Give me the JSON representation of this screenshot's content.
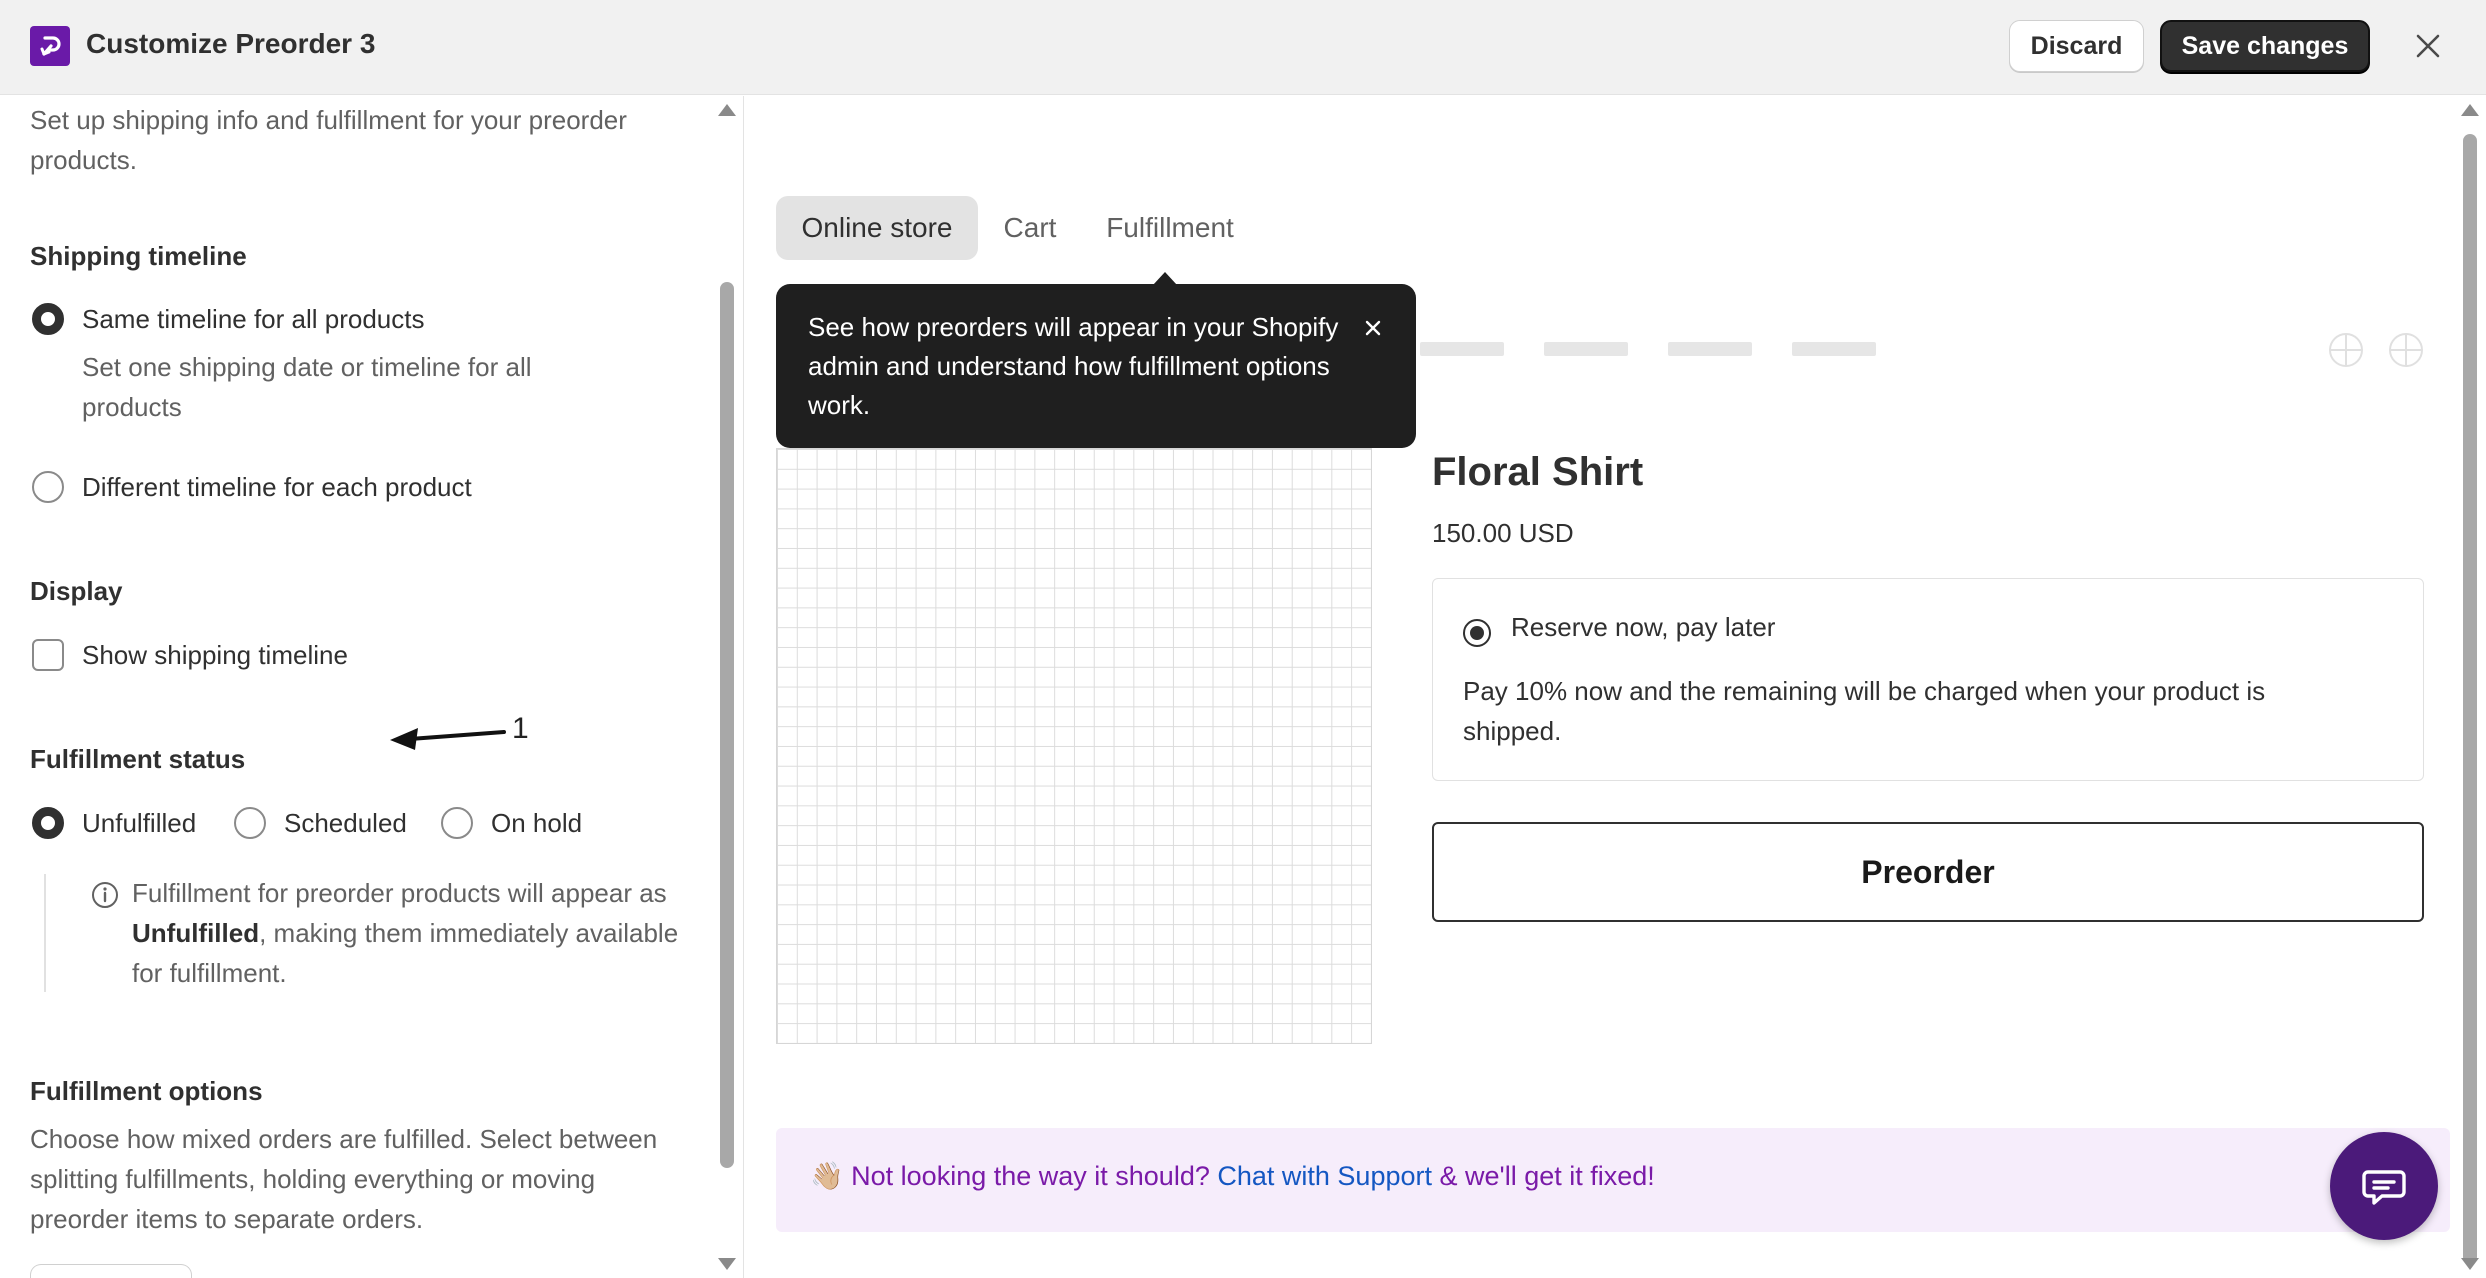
{
  "header": {
    "title": "Customize Preorder 3",
    "discard_label": "Discard",
    "save_label": "Save changes"
  },
  "left": {
    "intro": "Set up shipping info and fulfillment for your preorder products.",
    "shipping_timeline": {
      "heading": "Shipping timeline",
      "option1_label": "Same timeline for all products",
      "option1_help": "Set one shipping date or timeline for all products",
      "option2_label": "Different timeline for each product"
    },
    "display": {
      "heading": "Display",
      "checkbox_label": "Show shipping timeline",
      "checked": false
    },
    "annotation": "1",
    "fulfillment_status": {
      "heading": "Fulfillment status",
      "options": [
        "Unfulfilled",
        "Scheduled",
        "On hold"
      ],
      "selected": "Unfulfilled",
      "info_prefix": "Fulfillment for preorder products will appear as ",
      "info_bold": "Unfulfilled",
      "info_suffix": ", making them immediately available for fulfillment."
    },
    "fulfillment_options": {
      "heading": "Fulfillment options",
      "description": "Choose how mixed orders are fulfilled. Select between splitting fulfillments, holding everything or moving preorder items to separate orders."
    }
  },
  "preview": {
    "tabs": [
      "Online store",
      "Cart",
      "Fulfillment"
    ],
    "active_tab": "Online store",
    "tooltip": "See how preorders will appear in your Shopify admin and understand how fulfillment options work.",
    "product_title": "Floral Shirt",
    "price": "150.00 USD",
    "option_label": "Reserve now, pay later",
    "option_desc": "Pay 10% now and the remaining will be charged when your product is shipped.",
    "preorder_label": "Preorder",
    "support": {
      "emoji": "👋🏼",
      "prefix": "Not looking the way it should?",
      "link": "Chat with Support",
      "suffix": "& we'll get it fixed!"
    }
  },
  "colors": {
    "brand": "#6a1aa8",
    "save_bg": "#303030",
    "support_bg": "#f6edfb",
    "support_text": "#7a1aa8",
    "link": "#1457c2",
    "chat_fab": "#4b1a7a"
  },
  "icons": [
    "app-logo-icon",
    "close-icon",
    "info-icon",
    "close-tooltip-icon",
    "chat-icon",
    "arrow-annotation-icon"
  ]
}
